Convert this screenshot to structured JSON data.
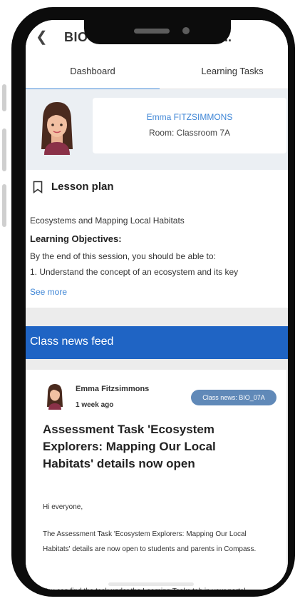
{
  "header": {
    "title": "BIO",
    "title_tail": "..."
  },
  "tabs": [
    {
      "label": "Dashboard"
    },
    {
      "label": "Learning Tasks"
    }
  ],
  "profile": {
    "teacher_name": "Emma FITZSIMMONS",
    "room": "Room: Classroom 7A"
  },
  "lesson_plan": {
    "heading": "Lesson plan",
    "topic": "Ecosystems and Mapping Local Habitats",
    "objectives_heading": "Learning Objectives:",
    "intro": "By the end of this session, you should be able to:",
    "item1": "1. Understand the concept of an ecosystem and its key",
    "see_more": "See more"
  },
  "news_feed": {
    "title": "Class news feed",
    "post": {
      "author": "Emma Fitzsimmons",
      "time": "1 week ago",
      "badge": "Class news: BIO_07A",
      "headline": "Assessment Task 'Ecosystem Explorers: Mapping Our Local Habitats' details now open",
      "greeting": "Hi everyone,",
      "paragraph1": "The Assessment Task 'Ecosystem Explorers: Mapping Our Local Habitats' details are now open to students and parents in Compass.",
      "paragraph2": "You can find the task under the Learning Tasks tab in your portal."
    }
  },
  "colors": {
    "accent": "#3f86d6",
    "feed_bar": "#1f64c4",
    "badge": "#6089b8"
  },
  "icons": {
    "back": "back-arrow-icon",
    "bookmark": "bookmark-icon"
  }
}
